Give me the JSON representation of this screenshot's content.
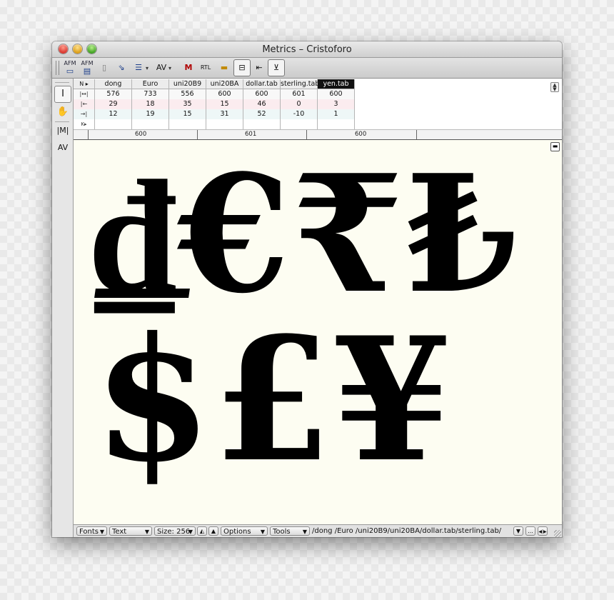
{
  "window": {
    "title": "Metrics – Cristoforo"
  },
  "toolbar": {
    "tools": [
      {
        "label": "AFM",
        "icon": "open-afm-icon"
      },
      {
        "label": "AFM",
        "icon": "save-afm-icon"
      },
      {
        "label": "",
        "icon": "clipboard-icon"
      },
      {
        "label": "",
        "icon": "import-icon"
      },
      {
        "label": "",
        "icon": "list-icon"
      },
      {
        "label": "AV",
        "icon": "kerning-icon"
      },
      {
        "label": "M",
        "icon": "metrics-icon"
      },
      {
        "label": "RTL",
        "icon": "rtl-icon"
      },
      {
        "label": "",
        "icon": "baseline-icon"
      },
      {
        "label": "",
        "icon": "window-icon"
      },
      {
        "label": "",
        "icon": "sidebearing-icon"
      },
      {
        "label": "",
        "icon": "dropdown-icon"
      }
    ]
  },
  "left_tools": [
    {
      "label": "I",
      "icon": "text-cursor-icon"
    },
    {
      "label": "✋",
      "icon": "hand-icon"
    },
    {
      "label": "|M|",
      "icon": "sidebearing-tool-icon"
    },
    {
      "label": "AV",
      "icon": "kern-tool-icon"
    }
  ],
  "metrics_table": {
    "header_label": "N ▸",
    "columns": [
      "dong",
      "Euro",
      "uni20B9",
      "uni20BA",
      "dollar.tab",
      "sterling.tab",
      "yen.tab"
    ],
    "active_column": "yen.tab",
    "rows": [
      {
        "icon": "advance-width-icon",
        "label": "|↔|",
        "values": [
          "576",
          "733",
          "556",
          "600",
          "600",
          "601",
          "600"
        ]
      },
      {
        "icon": "left-sidebearing-icon",
        "label": "|←",
        "values": [
          "29",
          "18",
          "35",
          "15",
          "46",
          "0",
          "3"
        ]
      },
      {
        "icon": "right-sidebearing-icon",
        "label": "→|",
        "values": [
          "12",
          "19",
          "15",
          "31",
          "52",
          "-10",
          "1"
        ]
      },
      {
        "icon": "kern-row-icon",
        "label": "K▸",
        "values": [
          "",
          "",
          "",
          "",
          "",
          "",
          ""
        ]
      }
    ]
  },
  "ruler": {
    "labels": [
      "600",
      "601",
      "600"
    ]
  },
  "canvas": {
    "line1": "₫€₹₺",
    "line2": "$£¥"
  },
  "statusbar": {
    "fonts": "Fonts",
    "text": "Text",
    "size": "Size: 256",
    "options": "Options",
    "tools": "Tools",
    "glyph_list": "/dong /Euro /uni20B9/uni20BA/dollar.tab/sterling.tab/",
    "buttons": [
      "▼",
      "...",
      "◀|▶"
    ]
  }
}
